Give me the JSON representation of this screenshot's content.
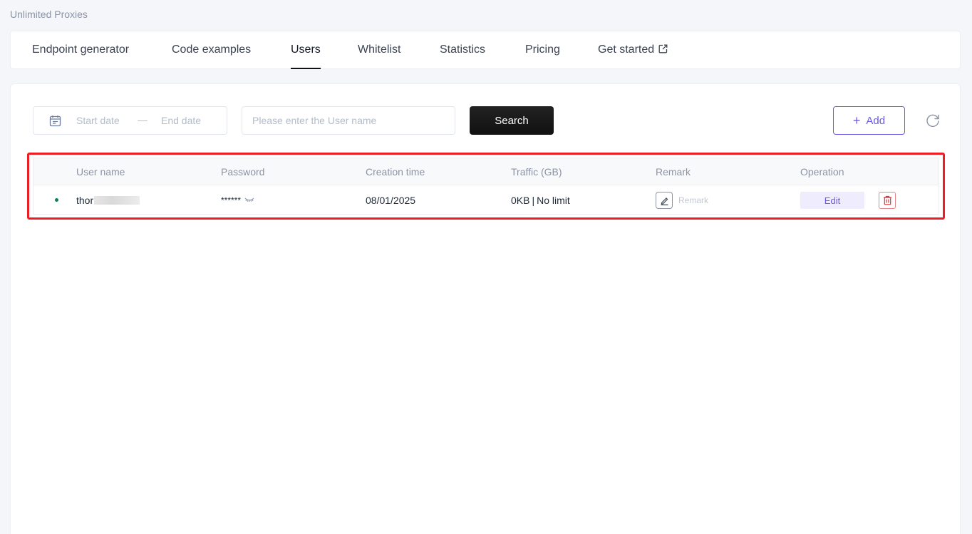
{
  "page": {
    "title": "Unlimited Proxies"
  },
  "tabs": [
    {
      "label": "Endpoint generator",
      "active": false
    },
    {
      "label": "Code examples",
      "active": false
    },
    {
      "label": "Users",
      "active": true
    },
    {
      "label": "Whitelist",
      "active": false
    },
    {
      "label": "Statistics",
      "active": false
    },
    {
      "label": "Pricing",
      "active": false
    },
    {
      "label": "Get started",
      "active": false,
      "icon": "external-link-icon"
    }
  ],
  "filters": {
    "start_date_placeholder": "Start date",
    "date_separator": "—",
    "end_date_placeholder": "End date",
    "username_placeholder": "Please enter the User name",
    "username_value": "",
    "search_label": "Search",
    "add_label": "Add",
    "add_icon": "plus-icon",
    "refresh_icon": "refresh-icon",
    "calendar_icon": "calendar-icon"
  },
  "table": {
    "columns": [
      "User name",
      "Password",
      "Creation time",
      "Traffic (GB)",
      "Remark",
      "Operation"
    ],
    "rows": [
      {
        "status_color": "#0f7b5f",
        "username_visible": "thor",
        "username_redacted": true,
        "password": "******",
        "password_toggle_icon": "eye-closed-icon",
        "creation_time": "08/01/2025",
        "traffic_used": "0KB",
        "traffic_separator": "|",
        "traffic_limit": "No limit",
        "remark_icon": "pencil-icon",
        "remark_placeholder": "Remark",
        "edit_label": "Edit",
        "delete_icon": "trash-icon"
      }
    ]
  },
  "colors": {
    "accent": "#6a5ae0",
    "danger": "#e3868a",
    "highlight": "#ee1d23",
    "status_active": "#0f7b5f"
  }
}
